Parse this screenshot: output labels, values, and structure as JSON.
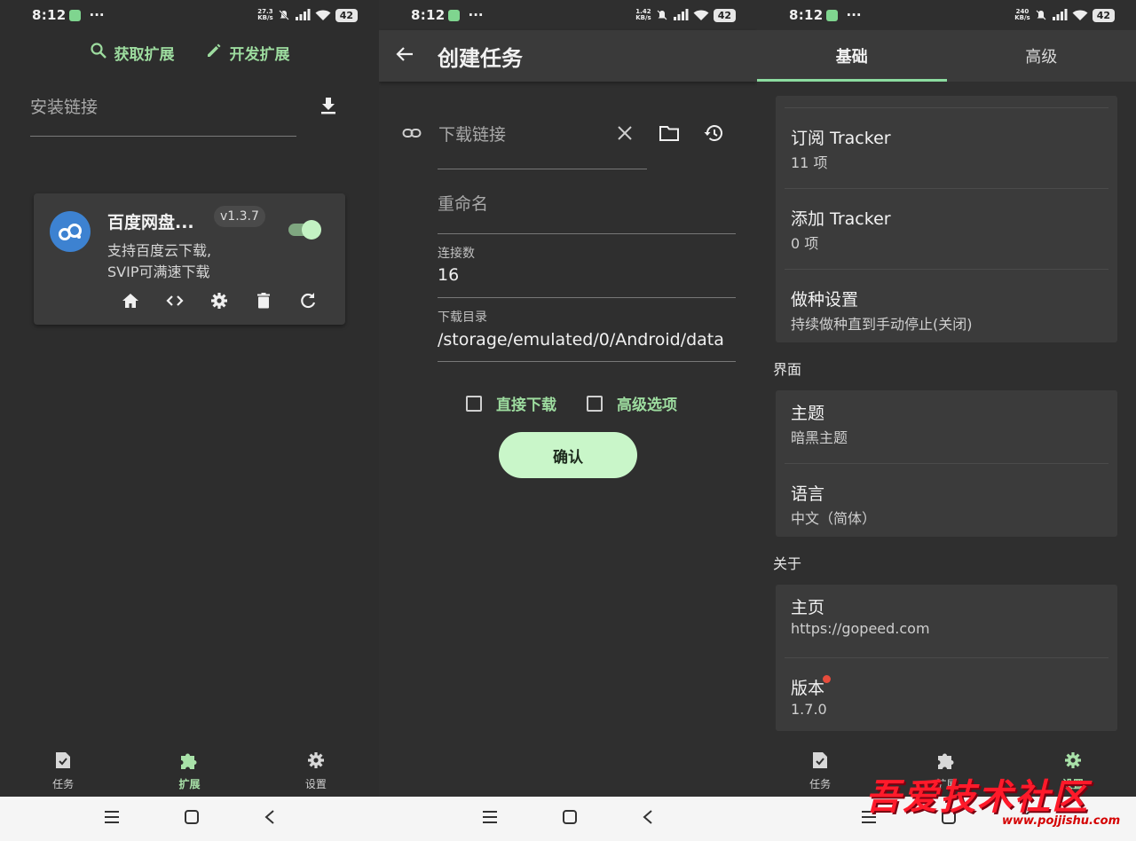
{
  "status_bars": [
    {
      "time": "8:12",
      "dots": "···",
      "speed_top": "27.3",
      "speed_bottom": "KB/s",
      "battery": "42"
    },
    {
      "time": "8:12",
      "dots": "···",
      "speed_top": "1.42",
      "speed_bottom": "KB/s",
      "battery": "42"
    },
    {
      "time": "8:12",
      "dots": "···",
      "speed_top": "240",
      "speed_bottom": "KB/s",
      "battery": "42"
    }
  ],
  "extensions": {
    "get_label": "获取扩展",
    "dev_label": "开发扩展",
    "install_placeholder": "安装链接",
    "card": {
      "name": "百度网盘...",
      "version": "v1.3.7",
      "enabled": true,
      "desc_line1": "支持百度云下载,",
      "desc_line2": "SVIP可满速下载"
    }
  },
  "bottom_nav": {
    "tasks": "任务",
    "extensions": "扩展",
    "settings": "设置"
  },
  "create_task": {
    "title": "创建任务",
    "url_placeholder": "下载链接",
    "rename_placeholder": "重命名",
    "connections_label": "连接数",
    "connections_value": "16",
    "dir_label": "下载目录",
    "dir_value": "/storage/emulated/0/Android/data",
    "direct_label": "直接下载",
    "advanced_label": "高级选项",
    "confirm_label": "确认"
  },
  "settings": {
    "tab_basic": "基础",
    "tab_advanced": "高级",
    "tracker_sub_title": "订阅 Tracker",
    "tracker_sub_value": "11 项",
    "tracker_add_title": "添加 Tracker",
    "tracker_add_value": "0 项",
    "seed_title": "做种设置",
    "seed_value": "持续做种直到手动停止(关闭)",
    "section_ui": "界面",
    "theme_title": "主题",
    "theme_value": "暗黑主题",
    "lang_title": "语言",
    "lang_value": "中文（简体）",
    "section_about": "关于",
    "home_title": "主页",
    "home_value": "https://gopeed.com",
    "version_title": "版本",
    "version_value": "1.7.0"
  },
  "watermark": {
    "text": "吾爱技术社区",
    "url": "www.pojjishu.com"
  },
  "colors": {
    "accent_green": "#9ddc9f",
    "confirm_bg": "#c9f6c9",
    "baidu_blue": "#3d82d1",
    "red_dot": "#e74c3c"
  }
}
